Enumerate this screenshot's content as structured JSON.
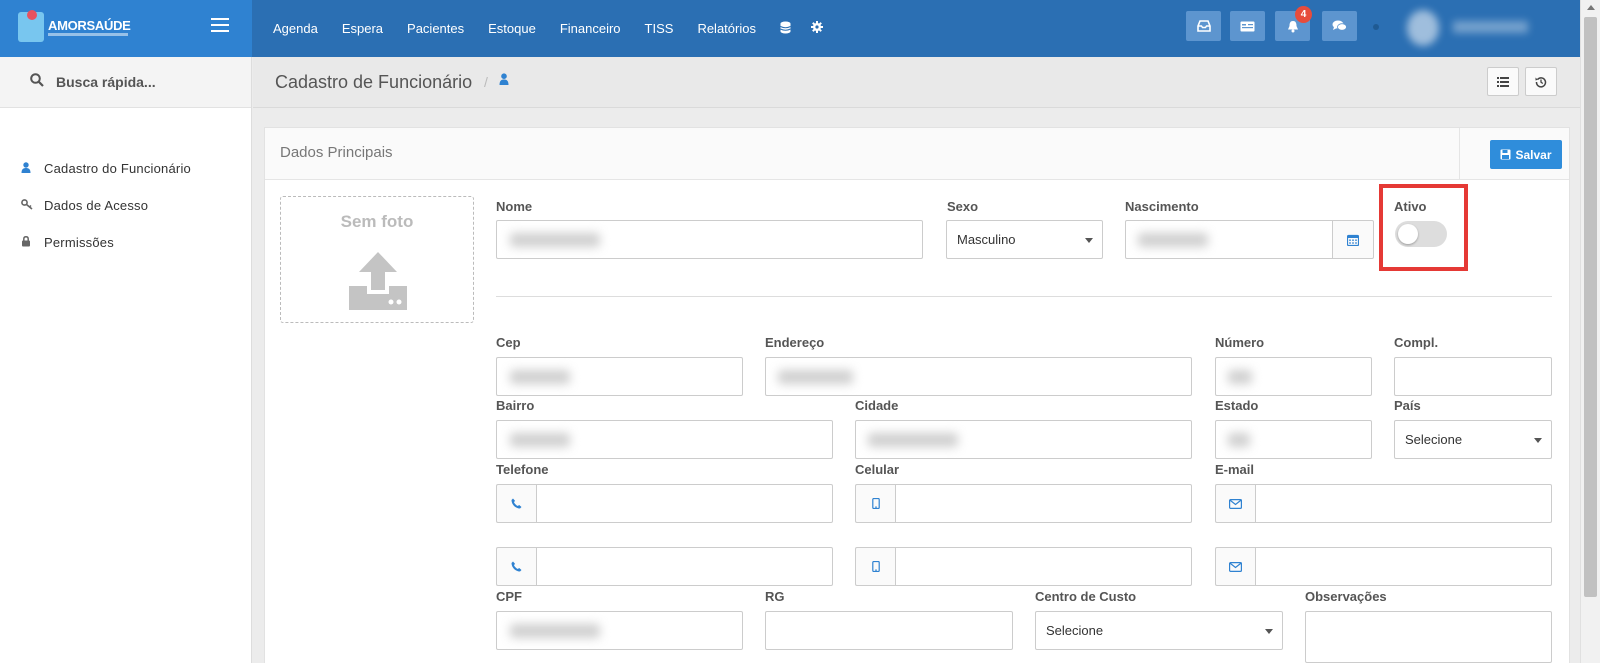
{
  "brand": {
    "name": "AMORSAÚDE"
  },
  "nav": {
    "items": [
      "Agenda",
      "Espera",
      "Pacientes",
      "Estoque",
      "Financeiro",
      "TISS",
      "Relatórios"
    ]
  },
  "topbar": {
    "notification_count": "4"
  },
  "sidebar": {
    "search_placeholder": "Busca rápida...",
    "items": [
      {
        "label": "Cadastro do Funcionário",
        "icon": "user-icon"
      },
      {
        "label": "Dados de Acesso",
        "icon": "key-icon"
      },
      {
        "label": "Permissões",
        "icon": "lock-icon"
      }
    ]
  },
  "header": {
    "title": "Cadastro de Funcionário",
    "separator": "/"
  },
  "panel": {
    "title": "Dados Principais",
    "save_label": "Salvar"
  },
  "photo": {
    "label": "Sem foto"
  },
  "form": {
    "labels": {
      "nome": "Nome",
      "sexo": "Sexo",
      "nascimento": "Nascimento",
      "ativo": "Ativo",
      "cep": "Cep",
      "endereco": "Endereço",
      "numero": "Número",
      "compl": "Compl.",
      "bairro": "Bairro",
      "cidade": "Cidade",
      "estado": "Estado",
      "pais": "País",
      "telefone": "Telefone",
      "celular": "Celular",
      "email": "E-mail",
      "cpf": "CPF",
      "rg": "RG",
      "centro_custo": "Centro de Custo",
      "observacoes": "Observações"
    },
    "sexo_value": "Masculino",
    "pais_value": "Selecione",
    "centro_custo_value": "Selecione",
    "ativo_on": false
  },
  "colors": {
    "topbar": "#2b6fb3",
    "brand": "#2f82d1",
    "accent": "#2f8ddb",
    "highlight": "#e53935"
  }
}
